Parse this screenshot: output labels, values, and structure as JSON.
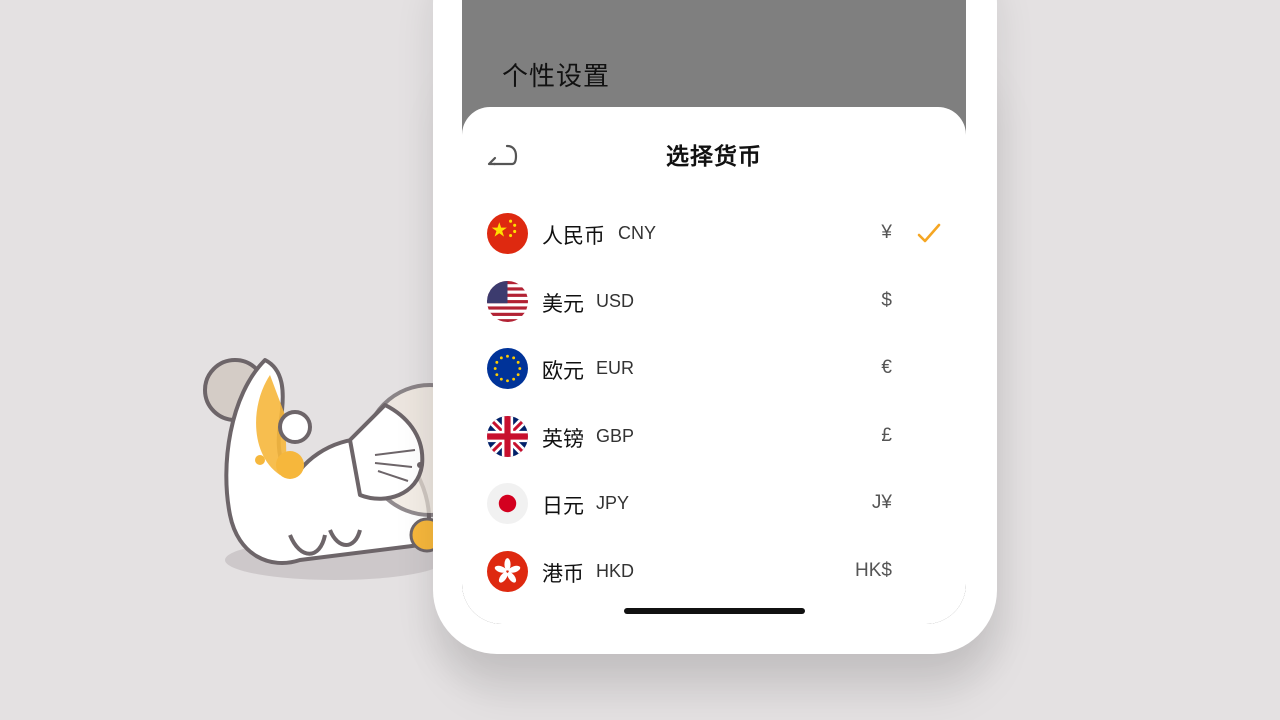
{
  "page": {
    "settings_title": "个性设置"
  },
  "sheet": {
    "title": "选择货币",
    "back_icon": "back-arrow-icon"
  },
  "currencies": [
    {
      "name": "人民币",
      "code": "CNY",
      "symbol": "¥",
      "flag": "china-flag-icon",
      "selected": true
    },
    {
      "name": "美元",
      "code": "USD",
      "symbol": "$",
      "flag": "usa-flag-icon",
      "selected": false
    },
    {
      "name": "欧元",
      "code": "EUR",
      "symbol": "€",
      "flag": "eu-flag-icon",
      "selected": false
    },
    {
      "name": "英镑",
      "code": "GBP",
      "symbol": "£",
      "flag": "uk-flag-icon",
      "selected": false
    },
    {
      "name": "日元",
      "code": "JPY",
      "symbol": "J¥",
      "flag": "japan-flag-icon",
      "selected": false
    },
    {
      "name": "港币",
      "code": "HKD",
      "symbol": "HK$",
      "flag": "hongkong-flag-icon",
      "selected": false
    }
  ],
  "colors": {
    "background": "#e4e1e2",
    "dim_overlay": "#7f7f7f",
    "accent_check": "#f5a623",
    "mascot_accent": "#f6b73c"
  }
}
